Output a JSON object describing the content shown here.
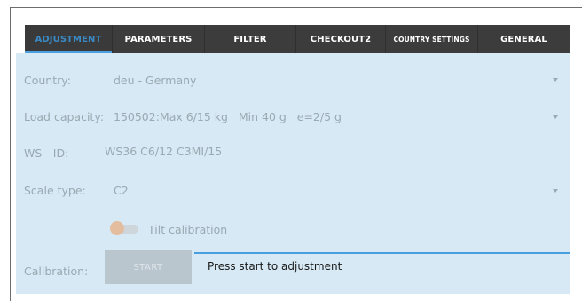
{
  "tabs": [
    {
      "label": "ADJUSTMENT",
      "active": true
    },
    {
      "label": "PARAMETERS",
      "active": false
    },
    {
      "label": "FILTER",
      "active": false
    },
    {
      "label": "CHECKOUT2",
      "active": false
    },
    {
      "label": "COUNTRY SETTINGS",
      "active": false
    },
    {
      "label": "GENERAL",
      "active": false
    }
  ],
  "form": {
    "country": {
      "label": "Country:",
      "value": "deu - Germany"
    },
    "load_capacity": {
      "label": "Load capacity:",
      "value": "150502:Max 6/15 kg   Min 40 g   e=2/5 g"
    },
    "ws_id": {
      "label": "WS - ID:",
      "value": "WS36 C6/12 C3MI/15"
    },
    "scale_type": {
      "label": "Scale type:",
      "value": "C2"
    },
    "tilt_calibration": {
      "label": "Tilt calibration",
      "enabled": false
    },
    "calibration": {
      "label": "Calibration:",
      "button_label": "START",
      "status": "Press start to adjustment"
    }
  },
  "colors": {
    "tab_bar": "#3c3c3c",
    "active_tab": "#3a8ac6",
    "panel_bg": "#d6e9f4",
    "muted_text": "#9aa9b2",
    "accent_line": "#4aa0de"
  }
}
